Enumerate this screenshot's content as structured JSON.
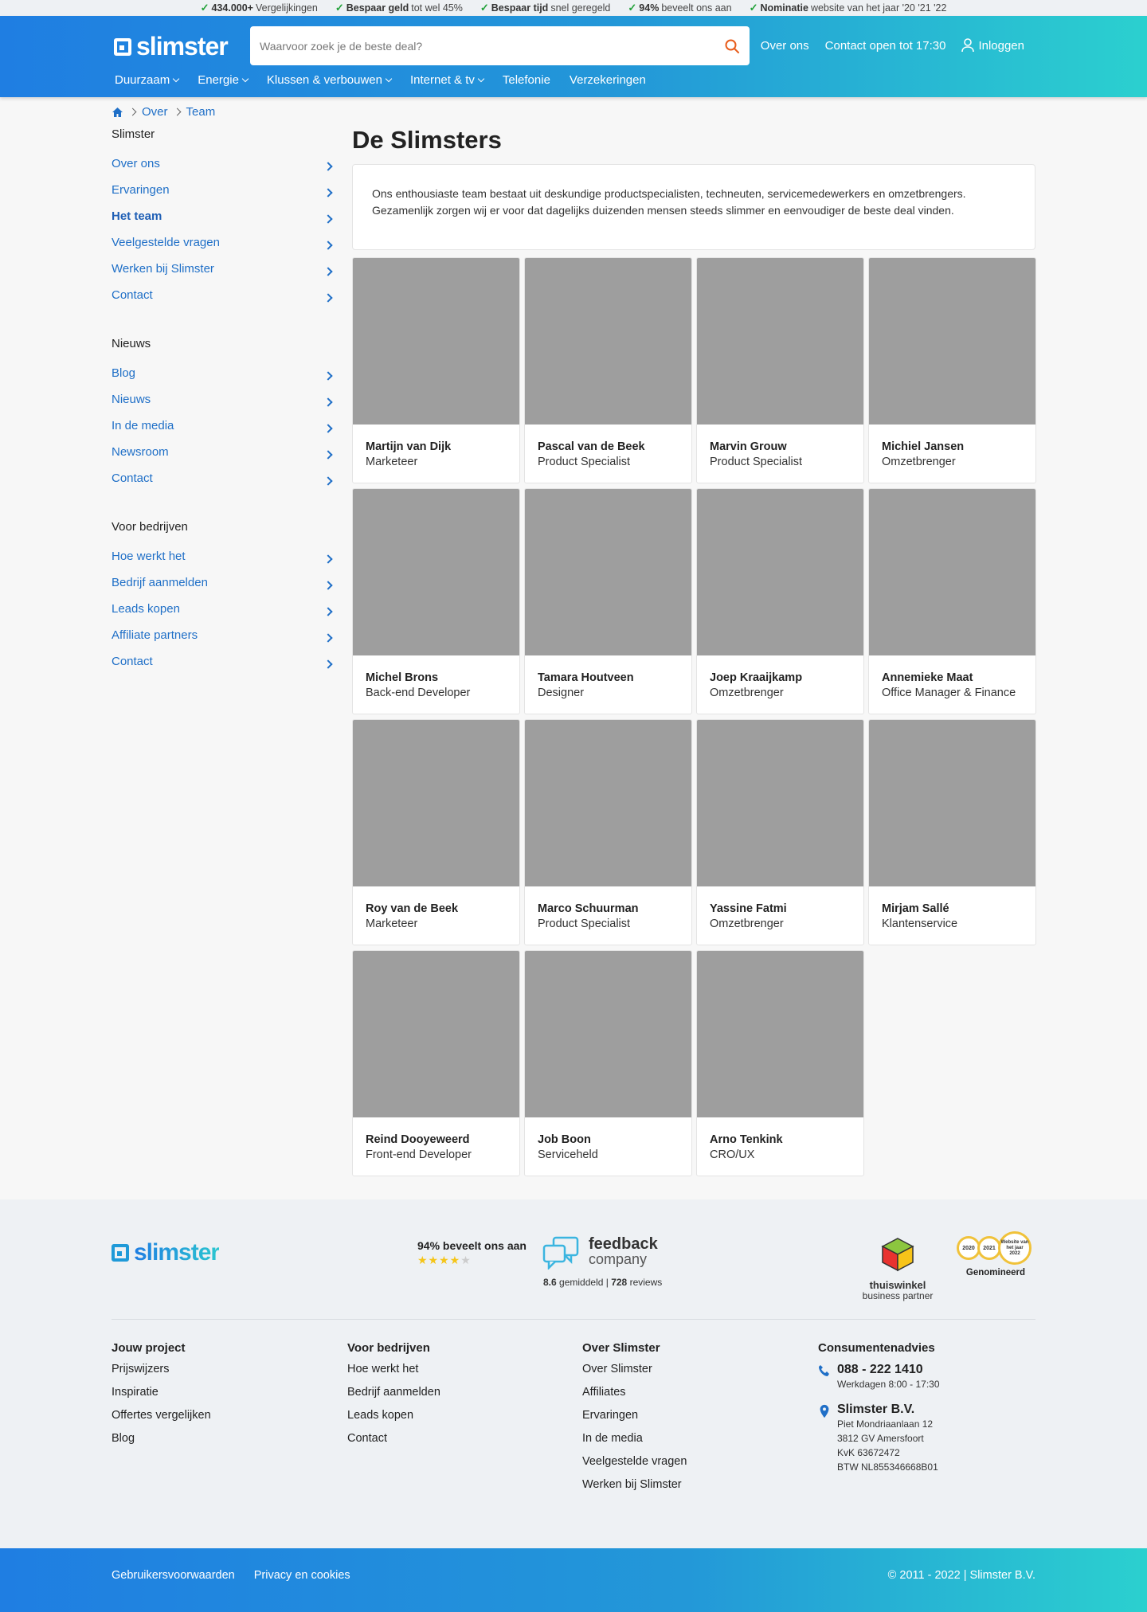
{
  "usp": [
    {
      "bold": "434.000+",
      "text": "Vergelijkingen"
    },
    {
      "bold": "Bespaar geld",
      "text": "tot wel 45%"
    },
    {
      "bold": "Bespaar tijd",
      "text": "snel geregeld"
    },
    {
      "bold": "94%",
      "text": "beveelt ons aan"
    },
    {
      "bold": "Nominatie",
      "text": "website van het jaar '20 '21 '22"
    }
  ],
  "header": {
    "logo": "slimster",
    "search_placeholder": "Waarvoor zoek je de beste deal?",
    "links": [
      "Over ons",
      "Contact open tot 17:30"
    ],
    "login": "Inloggen",
    "nav": [
      {
        "label": "Duurzaam",
        "dropdown": true
      },
      {
        "label": "Energie",
        "dropdown": true
      },
      {
        "label": "Klussen & verbouwen",
        "dropdown": true
      },
      {
        "label": "Internet & tv",
        "dropdown": true
      },
      {
        "label": "Telefonie",
        "dropdown": false
      },
      {
        "label": "Verzekeringen",
        "dropdown": false
      }
    ]
  },
  "breadcrumb": [
    "Over",
    "Team"
  ],
  "sidebar": [
    {
      "heading": "Slimster",
      "items": [
        "Over ons",
        "Ervaringen",
        "Het team",
        "Veelgestelde vragen",
        "Werken bij Slimster",
        "Contact"
      ],
      "active": "Het team"
    },
    {
      "heading": "Nieuws",
      "items": [
        "Blog",
        "Nieuws",
        "In de media",
        "Newsroom",
        "Contact"
      ]
    },
    {
      "heading": "Voor bedrijven",
      "items": [
        "Hoe werkt het",
        "Bedrijf aanmelden",
        "Leads kopen",
        "Affiliate partners",
        "Contact"
      ]
    }
  ],
  "main": {
    "title": "De Slimsters",
    "intro": "Ons enthousiaste team bestaat uit deskundige productspecialisten, techneuten, servicemedewerkers en omzetbrengers. Gezamenlijk zorgen wij er voor dat dagelijks duizenden mensen steeds slimmer en eenvoudiger de beste deal vinden."
  },
  "team": [
    {
      "name": "Martijn van Dijk",
      "role": "Marketeer"
    },
    {
      "name": "Pascal van de Beek",
      "role": "Product Specialist"
    },
    {
      "name": "Marvin Grouw",
      "role": "Product Specialist"
    },
    {
      "name": "Michiel Jansen",
      "role": "Omzetbrenger"
    },
    {
      "name": "Michel Brons",
      "role": "Back-end Developer"
    },
    {
      "name": "Tamara Houtveen",
      "role": "Designer"
    },
    {
      "name": "Joep Kraaijkamp",
      "role": "Omzetbrenger"
    },
    {
      "name": "Annemieke Maat",
      "role": "Office Manager & Finance"
    },
    {
      "name": "Roy van de Beek",
      "role": "Marketeer"
    },
    {
      "name": "Marco Schuurman",
      "role": "Product Specialist"
    },
    {
      "name": "Yassine Fatmi",
      "role": "Omzetbrenger"
    },
    {
      "name": "Mirjam Sallé",
      "role": "Klantenservice"
    },
    {
      "name": "Reind Dooyeweerd",
      "role": "Front-end Developer"
    },
    {
      "name": "Job Boon",
      "role": "Serviceheld"
    },
    {
      "name": "Arno Tenkink",
      "role": "CRO/UX"
    }
  ],
  "footer": {
    "logo": "slimster",
    "recommend": "94% beveelt ons aan",
    "rating_stars": 4.5,
    "feedback_company": {
      "line1": "feedback",
      "line2": "company",
      "score": "8.6",
      "score_label": "gemiddeld",
      "reviews": "728",
      "reviews_label": "reviews"
    },
    "thuiswinkel": {
      "line1": "thuiswinkel",
      "line2": "business partner"
    },
    "medals": [
      "2020",
      "2021",
      "Website van het jaar 2022"
    ],
    "nominated": "Genomineerd",
    "columns": [
      {
        "heading": "Jouw project",
        "items": [
          "Prijswijzers",
          "Inspiratie",
          "Offertes vergelijken",
          "Blog"
        ]
      },
      {
        "heading": "Voor bedrijven",
        "items": [
          "Hoe werkt het",
          "Bedrijf aanmelden",
          "Leads kopen",
          "Contact"
        ]
      },
      {
        "heading": "Over Slimster",
        "items": [
          "Over Slimster",
          "Affiliates",
          "Ervaringen",
          "In de media",
          "Veelgestelde vragen",
          "Werken bij Slimster"
        ]
      }
    ],
    "consumer": {
      "heading": "Consumentenadvies",
      "phone": "088 - 222 1410",
      "hours": "Werkdagen 8:00 - 17:30",
      "company": "Slimster B.V.",
      "address": [
        "Piet Mondriaanlaan 12",
        "3812 GV Amersfoort",
        "KvK 63672472",
        "BTW NL855346668B01"
      ]
    },
    "bottom_links": [
      "Gebruikersvoorwaarden",
      "Privacy en cookies"
    ],
    "copyright": "© 2011 - 2022 | Slimster B.V."
  },
  "colors": {
    "brand_blue": "#1f7ee2",
    "brand_teal": "#2bd0cf",
    "link": "#1f6fc7",
    "check": "#23a23a"
  }
}
